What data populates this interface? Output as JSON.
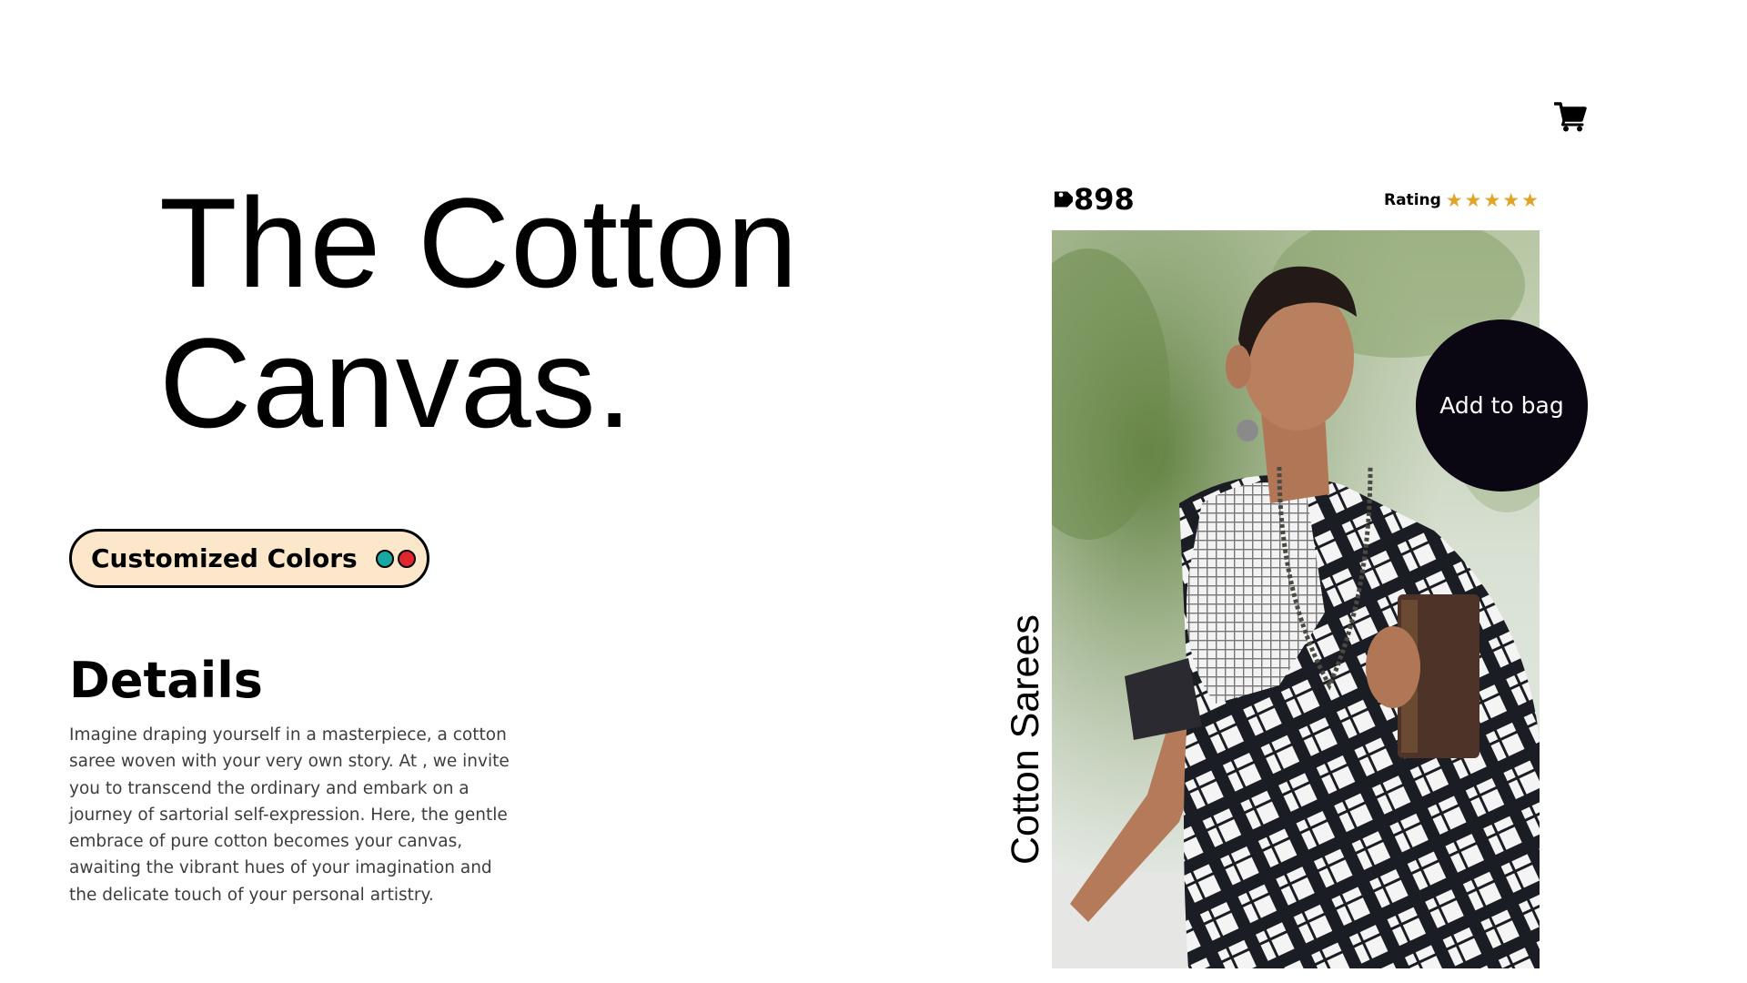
{
  "header": {
    "cart_icon": "shopping-cart-icon"
  },
  "hero": {
    "title_line1": "The Cotton",
    "title_line2": "Canvas."
  },
  "colors": {
    "label": "Customized Colors",
    "swatches": [
      "#17a8a2",
      "#e2262e"
    ]
  },
  "details": {
    "heading": "Details",
    "text": "Imagine draping yourself in a masterpiece, a cotton saree woven with your very own story. At , we invite you to transcend the ordinary and embark on a journey of sartorial self-expression. Here, the gentle embrace of pure cotton becomes your canvas, awaiting the vibrant hues of your imagination and the delicate touch of your personal artistry."
  },
  "product": {
    "price_icon": "price-tag-icon",
    "price": "898",
    "rating_label": "Rating",
    "rating_stars": 5,
    "category": "Cotton Sarees",
    "add_to_bag_label": "Add to bag",
    "image": "woman-in-checked-cotton-saree-photo"
  }
}
